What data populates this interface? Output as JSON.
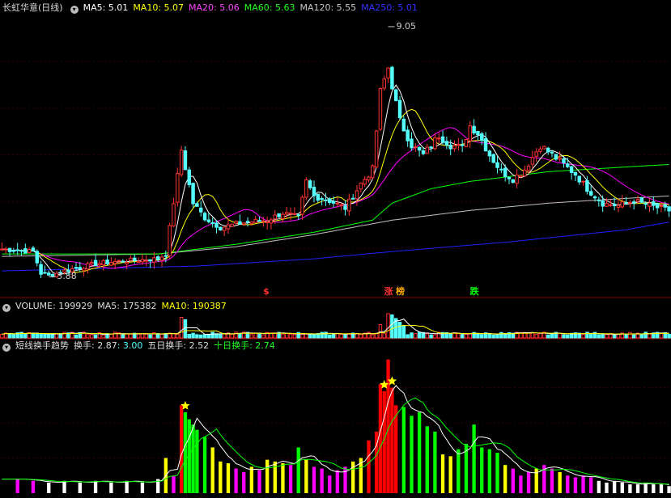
{
  "colors": {
    "bg": "#000000",
    "grid": "#3a0000",
    "sep": "#8b0000",
    "up": "#ff3232",
    "down": "#54ffff",
    "ma5": "#ffffff",
    "ma10": "#ffff00",
    "ma20": "#ff00ff",
    "ma60": "#00ff00",
    "ma120": "#c0c0c0",
    "ma250": "#2020ff",
    "bar_red": "#ff0000",
    "bar_green": "#00ff00",
    "bar_yellow": "#ffff00",
    "bar_magenta": "#ff00ff",
    "bar_white": "#ffffff"
  },
  "header": {
    "stock_title": "长虹华意(日线)",
    "menu_icon": "chevron-down-icon",
    "ma5": "MA5: 5.01",
    "ma10": "MA10: 5.07",
    "ma20": "MA20: 5.06",
    "ma60": "MA60: 5.63",
    "ma120": "MA120: 5.55",
    "ma250": "MA250: 5.01"
  },
  "volume_header": {
    "label": "VOLUME: 199929",
    "ma5": "MA5: 175382",
    "ma10": "MA10: 190387"
  },
  "turnover_header": {
    "label": "短线换手趋势",
    "t1": "换手: 2.87",
    "t2": ": 3.00",
    "t3": "五日换手: 2.52",
    "t4": "十日换手: 2.74"
  },
  "annotations": {
    "high": "9.05",
    "low": "3.88"
  },
  "signals": [
    {
      "text": "$",
      "color": "#ff3232",
      "day": 68
    },
    {
      "text": "涨",
      "color": "#ff3232",
      "day": 99
    },
    {
      "text": "榜",
      "color": "#ffaa00",
      "day": 102
    },
    {
      "text": "跌",
      "color": "#00ff00",
      "day": 121
    }
  ],
  "chart_data": [
    {
      "type": "candlestick",
      "name": "price",
      "ylim": [
        3.5,
        9.3
      ],
      "day_count": 172,
      "candle_anchors": [
        [
          0,
          4.45
        ],
        [
          8,
          4.4
        ],
        [
          10,
          3.95
        ],
        [
          12,
          3.9
        ],
        [
          16,
          4.0
        ],
        [
          24,
          4.15
        ],
        [
          30,
          4.2
        ],
        [
          40,
          4.25
        ],
        [
          42,
          4.35
        ],
        [
          46,
          6.5
        ],
        [
          49,
          5.4
        ],
        [
          52,
          5.1
        ],
        [
          56,
          4.9
        ],
        [
          62,
          5.0
        ],
        [
          68,
          5.05
        ],
        [
          72,
          5.2
        ],
        [
          76,
          5.1
        ],
        [
          78,
          5.85
        ],
        [
          80,
          5.55
        ],
        [
          84,
          5.45
        ],
        [
          88,
          5.3
        ],
        [
          92,
          5.8
        ],
        [
          95,
          6.1
        ],
        [
          97,
          7.7
        ],
        [
          99,
          8.2
        ],
        [
          102,
          7.1
        ],
        [
          105,
          6.6
        ],
        [
          108,
          6.4
        ],
        [
          112,
          6.8
        ],
        [
          115,
          6.6
        ],
        [
          118,
          6.55
        ],
        [
          120,
          7.0
        ],
        [
          122,
          6.85
        ],
        [
          125,
          6.4
        ],
        [
          128,
          6.05
        ],
        [
          131,
          5.9
        ],
        [
          134,
          6.1
        ],
        [
          138,
          6.6
        ],
        [
          141,
          6.4
        ],
        [
          144,
          6.2
        ],
        [
          147,
          6.0
        ],
        [
          150,
          5.7
        ],
        [
          154,
          5.4
        ],
        [
          158,
          5.35
        ],
        [
          162,
          5.45
        ],
        [
          166,
          5.35
        ],
        [
          171,
          5.25
        ]
      ],
      "ma_curves": {
        "ma120": [
          [
            0,
            4.3
          ],
          [
            40,
            4.35
          ],
          [
            60,
            4.5
          ],
          [
            80,
            4.75
          ],
          [
            100,
            5.05
          ],
          [
            120,
            5.25
          ],
          [
            140,
            5.4
          ],
          [
            160,
            5.5
          ],
          [
            171,
            5.55
          ]
        ],
        "ma250": [
          [
            0,
            4.0
          ],
          [
            50,
            4.1
          ],
          [
            80,
            4.25
          ],
          [
            100,
            4.4
          ],
          [
            130,
            4.6
          ],
          [
            160,
            4.85
          ],
          [
            171,
            5.01
          ]
        ],
        "ma60": [
          [
            0,
            4.35
          ],
          [
            40,
            4.35
          ],
          [
            60,
            4.55
          ],
          [
            80,
            4.8
          ],
          [
            95,
            5.05
          ],
          [
            100,
            5.4
          ],
          [
            110,
            5.7
          ],
          [
            120,
            5.85
          ],
          [
            130,
            5.95
          ],
          [
            140,
            6.05
          ],
          [
            150,
            6.1
          ],
          [
            160,
            6.15
          ],
          [
            171,
            6.2
          ]
        ]
      },
      "high": {
        "day": 99,
        "value": 9.05
      },
      "low": {
        "day": 12,
        "value": 3.88
      }
    },
    {
      "type": "bar",
      "name": "volume",
      "title": "VOLUME",
      "values_note": "relative volume per day",
      "spikes": [
        [
          46,
          0.85
        ],
        [
          47,
          0.75
        ],
        [
          97,
          0.55
        ],
        [
          99,
          1.0
        ],
        [
          100,
          0.95
        ],
        [
          101,
          0.8
        ],
        [
          102,
          0.65
        ],
        [
          103,
          0.5
        ]
      ],
      "ma5": 175382,
      "ma10": 190387,
      "volume": 199929
    },
    {
      "type": "bar",
      "name": "turnover",
      "title": "短线换手趋势",
      "ylim": [
        0,
        8
      ],
      "bars": [
        {
          "x": 4,
          "v": 0.8,
          "c": "m"
        },
        {
          "x": 8,
          "v": 0.7,
          "c": "m"
        },
        {
          "x": 12,
          "v": 0.6,
          "c": "w"
        },
        {
          "x": 16,
          "v": 0.7,
          "c": "w"
        },
        {
          "x": 20,
          "v": 0.6,
          "c": "w"
        },
        {
          "x": 24,
          "v": 0.7,
          "c": "w"
        },
        {
          "x": 28,
          "v": 0.6,
          "c": "w"
        },
        {
          "x": 32,
          "v": 0.7,
          "c": "w"
        },
        {
          "x": 36,
          "v": 0.6,
          "c": "w"
        },
        {
          "x": 40,
          "v": 0.8,
          "c": "w"
        },
        {
          "x": 42,
          "v": 2.0,
          "c": "y"
        },
        {
          "x": 44,
          "v": 1.0,
          "c": "m"
        },
        {
          "x": 46,
          "v": 5.0,
          "c": "r"
        },
        {
          "x": 47,
          "v": 4.6,
          "c": "g"
        },
        {
          "x": 48,
          "v": 4.2,
          "c": "g"
        },
        {
          "x": 49,
          "v": 3.9,
          "c": "g"
        },
        {
          "x": 50,
          "v": 3.6,
          "c": "g"
        },
        {
          "x": 52,
          "v": 3.2,
          "c": "g"
        },
        {
          "x": 54,
          "v": 2.6,
          "c": "y"
        },
        {
          "x": 56,
          "v": 1.8,
          "c": "y"
        },
        {
          "x": 58,
          "v": 1.7,
          "c": "y"
        },
        {
          "x": 60,
          "v": 1.4,
          "c": "m"
        },
        {
          "x": 62,
          "v": 1.2,
          "c": "m"
        },
        {
          "x": 64,
          "v": 1.5,
          "c": "y"
        },
        {
          "x": 66,
          "v": 1.3,
          "c": "m"
        },
        {
          "x": 68,
          "v": 1.9,
          "c": "y"
        },
        {
          "x": 70,
          "v": 1.8,
          "c": "y"
        },
        {
          "x": 72,
          "v": 1.7,
          "c": "y"
        },
        {
          "x": 74,
          "v": 1.6,
          "c": "m"
        },
        {
          "x": 76,
          "v": 2.6,
          "c": "g"
        },
        {
          "x": 78,
          "v": 1.9,
          "c": "y"
        },
        {
          "x": 80,
          "v": 1.5,
          "c": "m"
        },
        {
          "x": 82,
          "v": 1.4,
          "c": "m"
        },
        {
          "x": 84,
          "v": 1.0,
          "c": "m"
        },
        {
          "x": 86,
          "v": 1.3,
          "c": "m"
        },
        {
          "x": 88,
          "v": 1.5,
          "c": "m"
        },
        {
          "x": 90,
          "v": 1.8,
          "c": "y"
        },
        {
          "x": 92,
          "v": 2.0,
          "c": "y"
        },
        {
          "x": 94,
          "v": 3.0,
          "c": "r"
        },
        {
          "x": 96,
          "v": 3.5,
          "c": "r"
        },
        {
          "x": 97,
          "v": 6.2,
          "c": "r"
        },
        {
          "x": 98,
          "v": 5.8,
          "c": "r"
        },
        {
          "x": 99,
          "v": 7.6,
          "c": "r"
        },
        {
          "x": 100,
          "v": 6.0,
          "c": "r"
        },
        {
          "x": 101,
          "v": 5.0,
          "c": "r"
        },
        {
          "x": 103,
          "v": 4.9,
          "c": "g"
        },
        {
          "x": 105,
          "v": 4.4,
          "c": "g"
        },
        {
          "x": 107,
          "v": 4.6,
          "c": "g"
        },
        {
          "x": 109,
          "v": 3.8,
          "c": "g"
        },
        {
          "x": 111,
          "v": 3.5,
          "c": "g"
        },
        {
          "x": 113,
          "v": 2.2,
          "c": "y"
        },
        {
          "x": 115,
          "v": 2.1,
          "c": "y"
        },
        {
          "x": 117,
          "v": 2.5,
          "c": "g"
        },
        {
          "x": 119,
          "v": 2.8,
          "c": "g"
        },
        {
          "x": 121,
          "v": 3.9,
          "c": "g"
        },
        {
          "x": 123,
          "v": 2.6,
          "c": "g"
        },
        {
          "x": 125,
          "v": 2.5,
          "c": "g"
        },
        {
          "x": 127,
          "v": 2.3,
          "c": "g"
        },
        {
          "x": 129,
          "v": 1.6,
          "c": "y"
        },
        {
          "x": 131,
          "v": 1.4,
          "c": "m"
        },
        {
          "x": 133,
          "v": 1.0,
          "c": "m"
        },
        {
          "x": 135,
          "v": 1.2,
          "c": "m"
        },
        {
          "x": 137,
          "v": 1.4,
          "c": "y"
        },
        {
          "x": 139,
          "v": 1.6,
          "c": "m"
        },
        {
          "x": 141,
          "v": 1.4,
          "c": "m"
        },
        {
          "x": 143,
          "v": 1.2,
          "c": "y"
        },
        {
          "x": 145,
          "v": 1.0,
          "c": "m"
        },
        {
          "x": 147,
          "v": 0.9,
          "c": "m"
        },
        {
          "x": 149,
          "v": 1.0,
          "c": "m"
        },
        {
          "x": 151,
          "v": 0.9,
          "c": "m"
        },
        {
          "x": 153,
          "v": 0.7,
          "c": "w"
        },
        {
          "x": 155,
          "v": 0.6,
          "c": "w"
        },
        {
          "x": 157,
          "v": 0.7,
          "c": "w"
        },
        {
          "x": 159,
          "v": 0.6,
          "c": "w"
        },
        {
          "x": 161,
          "v": 0.5,
          "c": "w"
        },
        {
          "x": 163,
          "v": 0.5,
          "c": "w"
        },
        {
          "x": 165,
          "v": 0.6,
          "c": "w"
        },
        {
          "x": 167,
          "v": 0.5,
          "c": "w"
        },
        {
          "x": 169,
          "v": 0.5,
          "c": "w"
        },
        {
          "x": 171,
          "v": 0.4,
          "c": "w"
        }
      ],
      "stars": [
        47,
        98,
        100
      ],
      "turnover": 2.87,
      "five_day": 2.52,
      "ten_day": 2.74
    }
  ]
}
